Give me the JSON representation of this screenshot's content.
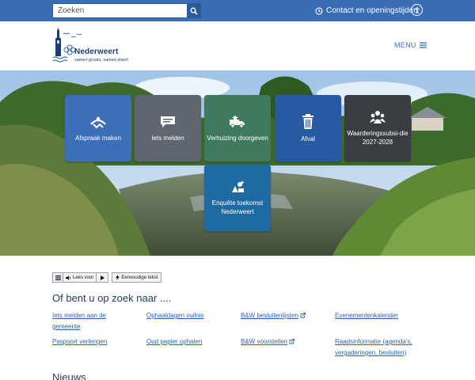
{
  "search": {
    "placeholder": "Zoeken"
  },
  "topbar": {
    "contact_label": "Contact en openingstijden"
  },
  "header": {
    "logo_title": "Nederweert",
    "logo_slogan": "samen groots, samen doen!",
    "menu_label": "MENU"
  },
  "tiles": [
    {
      "label": "Afspraak maken",
      "icon": "calendar-handshake-icon",
      "color": "#3d6fb6"
    },
    {
      "label": "Iets melden",
      "icon": "speech-bubble-icon",
      "color": "#5f6670"
    },
    {
      "label": "Verhuizing doorgeven",
      "icon": "moving-truck-icon",
      "color": "#3f7a5e"
    },
    {
      "label": "Afval",
      "icon": "trash-can-icon",
      "color": "#275aa0"
    },
    {
      "label": "Waarderingssubsi-die 2027-2028",
      "icon": "people-group-icon",
      "color": "#3a3d42"
    },
    {
      "label": "Enquête toekomst Nederweert",
      "icon": "survey-sparkle-icon",
      "color": "#1f6aa3"
    }
  ],
  "readspeaker": {
    "read_label": "Lees voor",
    "simple_text_label": "Eenvoudige tekst"
  },
  "lookfor": {
    "title": "Of bent u op zoek naar ....",
    "links": [
      {
        "label": "Iets melden aan de gemeente",
        "external": false
      },
      {
        "label": "Ophaaldagen vuilnis",
        "external": false
      },
      {
        "label": "B&W besluitenlijsten",
        "external": true
      },
      {
        "label": "Evenementenkalender",
        "external": false
      },
      {
        "label": "Paspoort verlengen",
        "external": false
      },
      {
        "label": "Oud papier ophalen",
        "external": false
      },
      {
        "label": "B&W voorstellen",
        "external": true
      },
      {
        "label": "Raadsinformatie (agenda's, vergaderingen, besluiten)",
        "external": false
      }
    ]
  },
  "news": {
    "title": "Nieuws"
  },
  "colors": {
    "brand_blue": "#3b6db3",
    "link": "#2a63b0",
    "heading": "#1f3a5f"
  }
}
